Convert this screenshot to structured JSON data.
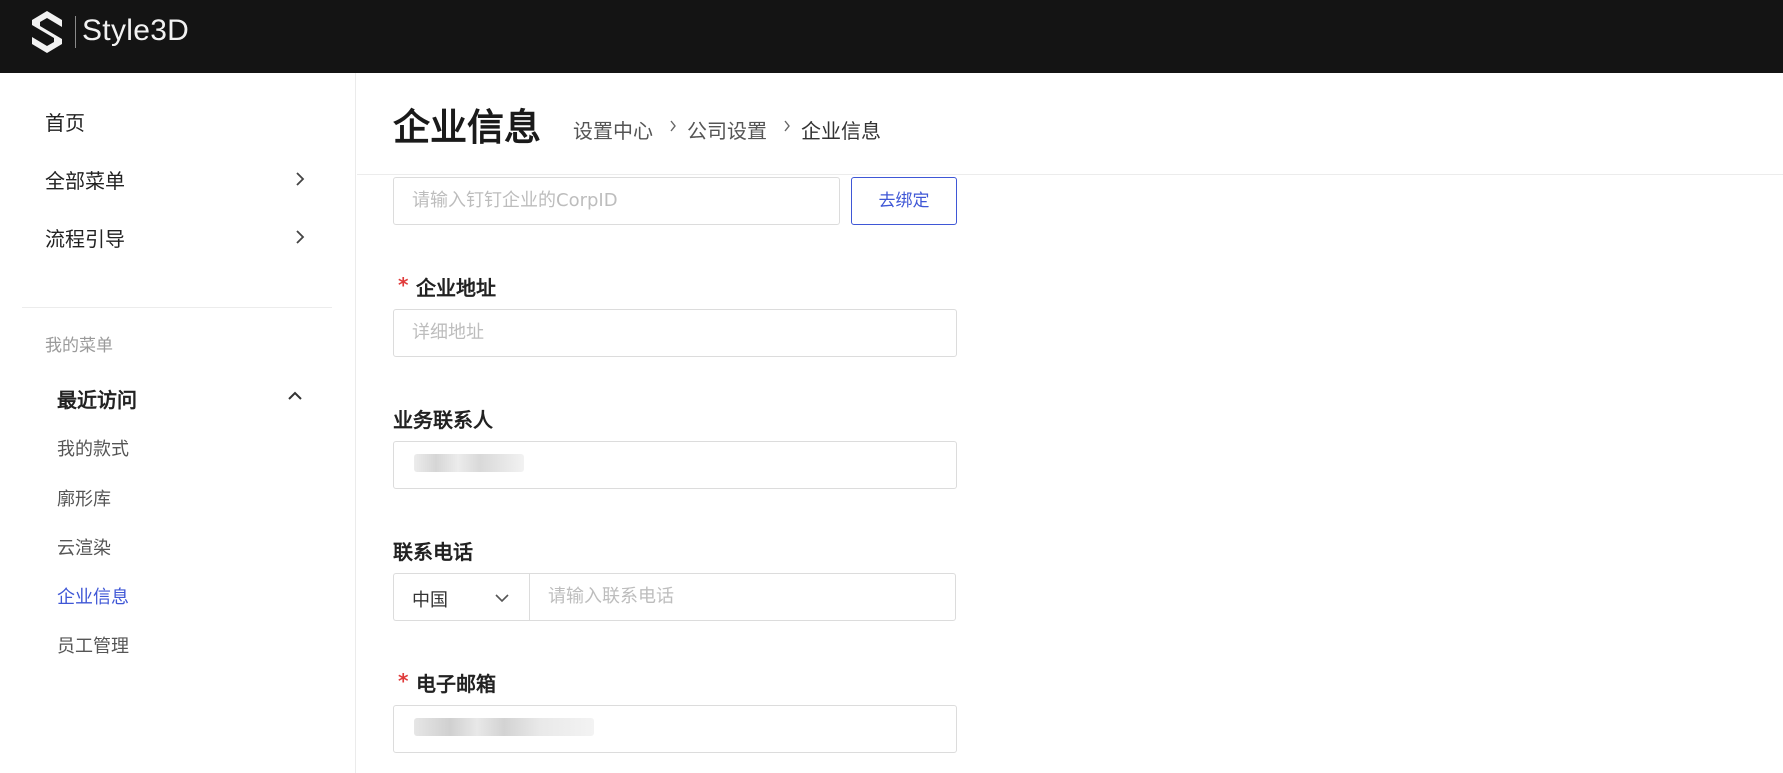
{
  "app": {
    "brand": "Style3D"
  },
  "sidebar": {
    "items": [
      {
        "label": "首页",
        "has_arrow": false
      },
      {
        "label": "全部菜单",
        "has_arrow": true
      },
      {
        "label": "流程引导",
        "has_arrow": true
      }
    ],
    "section_label": "我的菜单",
    "recent": {
      "title": "最近访问",
      "expanded": true,
      "items": [
        {
          "label": "我的款式",
          "active": false
        },
        {
          "label": "廓形库",
          "active": false
        },
        {
          "label": "云渲染",
          "active": false
        },
        {
          "label": "企业信息",
          "active": true
        },
        {
          "label": "员工管理",
          "active": false
        }
      ]
    }
  },
  "header": {
    "title": "企业信息",
    "breadcrumb": [
      "设置中心",
      "公司设置",
      "企业信息"
    ]
  },
  "form": {
    "corpid": {
      "placeholder": "请输入钉钉企业的CorpID",
      "button_label": "去绑定"
    },
    "address": {
      "label": "企业地址",
      "required": true,
      "placeholder": "详细地址"
    },
    "contact": {
      "label": "业务联系人",
      "required": false,
      "value_redacted": true
    },
    "phone": {
      "label": "联系电话",
      "required": false,
      "country": "中国",
      "placeholder": "请输入联系电话"
    },
    "email": {
      "label": "电子邮箱",
      "required": true,
      "value_redacted": true
    }
  },
  "colors": {
    "topbar": "#141414",
    "accent": "#3f57d6",
    "required": "#e03b3b",
    "placeholder": "#bdbdbd"
  },
  "icons": {
    "logo": "style3d-logo-icon",
    "expand": "chevron-right-icon",
    "collapse": "chevron-up-icon",
    "select": "chevron-down-icon",
    "breadcrumb_separator": "chevron-right-icon"
  }
}
